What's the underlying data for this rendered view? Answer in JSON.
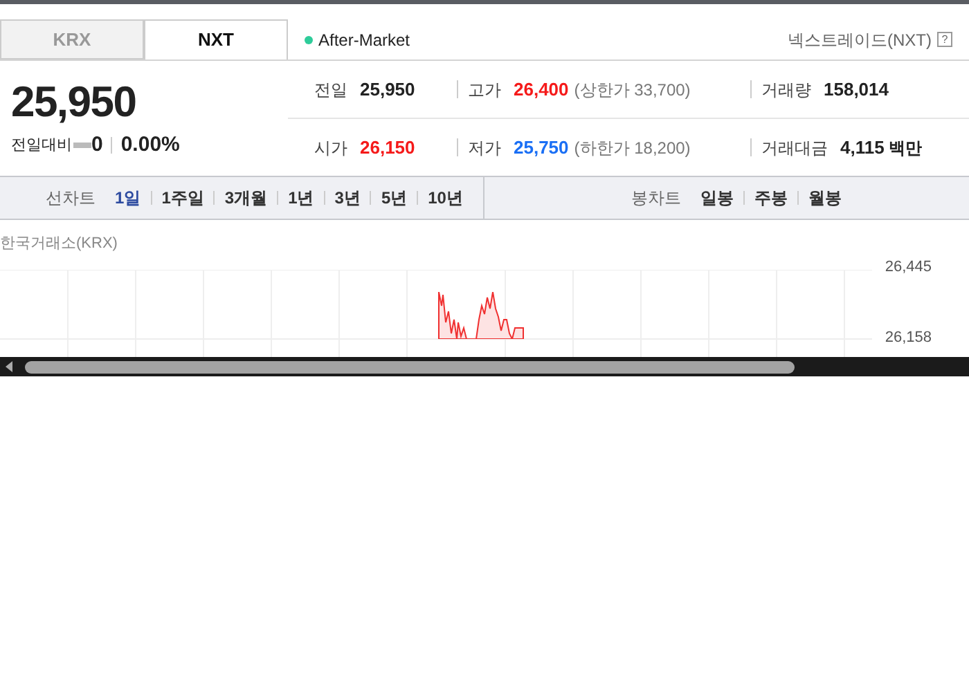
{
  "market_tabs": [
    {
      "label": "KRX",
      "selected": false
    },
    {
      "label": "NXT",
      "selected": true
    }
  ],
  "session": {
    "label": "After-Market",
    "color": "#2ecc9a"
  },
  "exchange_link": {
    "label": "넥스트레이드(NXT)",
    "help": "?"
  },
  "price": {
    "current": "25,950",
    "change_label": "전일대비",
    "change": "0",
    "change_rate": "0.00%"
  },
  "stats": [
    {
      "label": "전일",
      "value": "25,950",
      "color": "#222222"
    },
    {
      "label": "고가",
      "value": "26,400",
      "color": "#f51a1a",
      "limit": "(상한가 33,700)"
    },
    {
      "label": "거래량",
      "value": "158,014",
      "color": "#222222"
    },
    {
      "label": "시가",
      "value": "26,150",
      "color": "#f51a1a"
    },
    {
      "label": "저가",
      "value": "25,750",
      "color": "#1a6ff5",
      "limit": "(하한가 18,200)"
    },
    {
      "label": "거래대금",
      "value": "4,115",
      "unit": "백만",
      "color": "#222222"
    }
  ],
  "line_chart": {
    "label": "선차트",
    "periods": [
      {
        "label": "1일",
        "selected": true
      },
      {
        "label": "1주일",
        "selected": false
      },
      {
        "label": "3개월",
        "selected": false
      },
      {
        "label": "1년",
        "selected": false
      },
      {
        "label": "3년",
        "selected": false
      },
      {
        "label": "5년",
        "selected": false
      },
      {
        "label": "10년",
        "selected": false
      }
    ]
  },
  "candle_chart": {
    "label": "봉차트",
    "periods": [
      {
        "label": "일봉",
        "selected": false
      },
      {
        "label": "주봉",
        "selected": false
      },
      {
        "label": "월봉",
        "selected": false
      }
    ]
  },
  "chart": {
    "source": "한국거래소(KRX)",
    "y_ticks": [
      "26,445",
      "26,158"
    ]
  }
}
